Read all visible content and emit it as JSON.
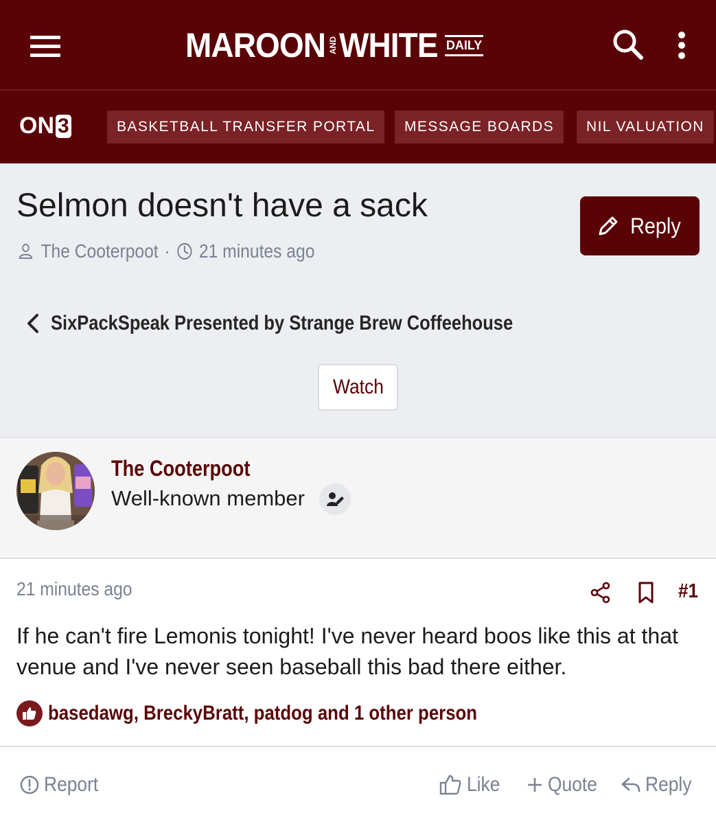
{
  "header": {
    "logo_word1": "MAROON",
    "logo_and": "AND",
    "logo_word2": "WHITE",
    "logo_daily": "DAILY"
  },
  "nav": {
    "brand": "ON",
    "brand_num": "3",
    "items": [
      "BASKETBALL TRANSFER PORTAL",
      "MESSAGE BOARDS",
      "NIL VALUATION"
    ]
  },
  "thread": {
    "title": "Selmon doesn't have a sack",
    "author": "The Cooterpoot",
    "separator": "·",
    "time": "21 minutes ago",
    "reply_label": "Reply",
    "forum": "SixPackSpeak Presented by Strange Brew Coffeehouse",
    "watch_label": "Watch"
  },
  "post": {
    "username": "The Cooterpoot",
    "user_title": "Well-known member",
    "time": "21 minutes ago",
    "number": "#1",
    "body": "If he can't fire Lemonis tonight! I've never heard boos like this at that venue and I've never seen baseball this bad there either.",
    "reactions": "basedawg, BreckyBratt, patdog and 1 other person",
    "actions": {
      "report": "Report",
      "like": "Like",
      "quote": "Quote",
      "reply": "Reply"
    }
  },
  "colors": {
    "brand": "#5a0306",
    "nav_pill": "#7a2225",
    "muted": "#7a8191",
    "header_bg": "#eceef1"
  }
}
